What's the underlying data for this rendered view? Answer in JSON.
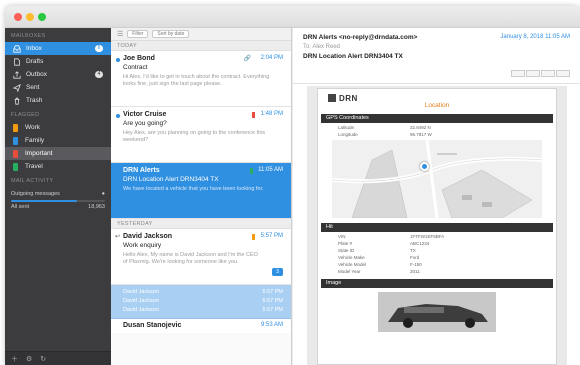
{
  "sidebar": {
    "mailboxes_heading": "MAILBOXES",
    "mailboxes": [
      {
        "label": "Inbox",
        "badge": "6",
        "icon": "inbox-icon",
        "active": true
      },
      {
        "label": "Drafts",
        "icon": "draft-icon"
      },
      {
        "label": "Outbox",
        "badge": "4",
        "icon": "outbox-icon"
      },
      {
        "label": "Sent",
        "icon": "sent-icon"
      },
      {
        "label": "Trash",
        "icon": "trash-icon"
      }
    ],
    "flagged_heading": "FLAGGED",
    "tags": [
      {
        "label": "Work",
        "color": "#f39c12"
      },
      {
        "label": "Family",
        "color": "#2f8fe0"
      },
      {
        "label": "Important",
        "color": "#e74c3c",
        "selected": true
      },
      {
        "label": "Travel",
        "color": "#27ae60"
      }
    ],
    "activity_heading": "MAIL ACTIVITY",
    "activity_title": "Outgoing messages",
    "activity_left": "All sent",
    "activity_right": "18,963"
  },
  "list": {
    "toolbar": [
      "Filter",
      "Sort by date"
    ],
    "today_heading": "TODAY",
    "yesterday_heading": "YESTERDAY",
    "messages": [
      {
        "from": "Joe Bond",
        "time": "2:04 PM",
        "subject": "Contract",
        "preview": "Hi Alex, I'd like to get in touch about the contract. Everything looks fine, just sign the last page please."
      },
      {
        "from": "Victor Cruise",
        "time": "1:48 PM",
        "subject": "Are you going?",
        "preview": "Hey Alex, are you planning on going to the conference this weekend?"
      },
      {
        "from": "DRN Alerts",
        "time": "11:05 AM",
        "subject": "DRN Location Alert DRN3404 TX",
        "preview": "We have located a vehicle that you have been looking for."
      },
      {
        "from": "David Jackson",
        "time": "5:57 PM",
        "subject": "Work enquiry",
        "preview": "Hello Alex, My name is David Jackson and I'm the CEO of Plaxmig. We're looking for someone like you.",
        "replies": "3"
      }
    ],
    "thread": [
      {
        "from": "David Jackson",
        "time": "5:57 PM"
      },
      {
        "from": "David Jackson",
        "time": "5:57 PM"
      },
      {
        "from": "David Jackson",
        "time": "5:57 PM"
      }
    ],
    "last": {
      "from": "Dusan Stanojevic",
      "time": "9:53 AM"
    }
  },
  "reader": {
    "from": "DRN Alerts <no-reply@drndata.com>",
    "to": "To: Alex Reed",
    "subject": "DRN Location Alert DRN3404 TX",
    "date": "January 8, 2018 11:05 AM",
    "email": {
      "logo": "DRN",
      "location_title": "Location",
      "gps_heading": "GPS Coordinates",
      "gps": [
        {
          "k": "Latitude",
          "v": "32.8492 N"
        },
        {
          "k": "Longitude",
          "v": "96.7817 W"
        }
      ],
      "hit_heading": "Hit",
      "hit": [
        {
          "k": "VIN",
          "v": "1FTFW1EF5BFA"
        },
        {
          "k": "Plate #",
          "v": "ABC1234"
        },
        {
          "k": "State ID",
          "v": "TX"
        },
        {
          "k": "Vehicle Make",
          "v": "Ford"
        },
        {
          "k": "Vehicle Model",
          "v": "F-150"
        },
        {
          "k": "Model Year",
          "v": "2011"
        }
      ],
      "image_heading": "Image"
    }
  }
}
